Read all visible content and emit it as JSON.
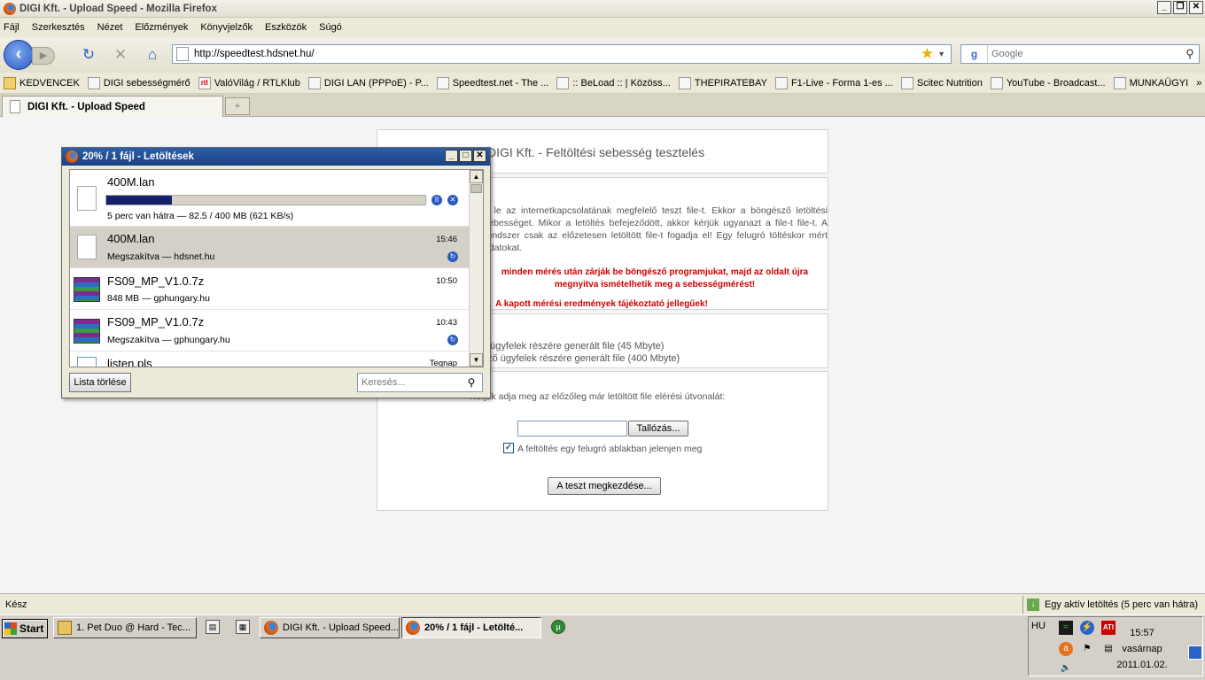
{
  "window": {
    "title": "DIGI Kft. - Upload Speed - Mozilla Firefox"
  },
  "menu": [
    "Fájl",
    "Szerkesztés",
    "Nézet",
    "Előzmények",
    "Könyvjelzők",
    "Eszközök",
    "Súgó"
  ],
  "nav": {
    "url": "http://speedtest.hdsnet.hu/",
    "search_placeholder": "Google"
  },
  "bookmarks": [
    "KEDVENCEK",
    "DIGI sebességmérő",
    "ValóVilág / RTLKlub",
    "DIGI LAN (PPPoE) - P...",
    "Speedtest.net - The ...",
    ":: BeLoad :: | Közöss...",
    "THEPIRATEBAY",
    "F1-Live - Forma 1-es ...",
    "Scitec Nutrition",
    "YouTube - Broadcast...",
    "MUNKAÜGYI"
  ],
  "bookmark_overflow": "»",
  "tab": {
    "label": "DIGI Kft. - Upload Speed"
  },
  "page": {
    "heading": "DIGI Kft. - Feltöltési sebesség tesztelés",
    "info_text": "e le az internetkapcsolatának megfelelő teszt file-t. Ekkor a böngésző letöltési sebességet. Mikor a letöltés befejeződött, akkor kérjük ugyanazt a file-t file-t. A rendszer csak az előzetesen letöltött file-t fogadja el! Egy felugró töltéskor mért adatokat.",
    "warning1": "minden mérés után zárják be böngésző programjukat, majd az oldalt újra megnyitva ismételhetik meg a sebességmérést!",
    "warning2": "A kapott mérési eredmények tájékoztató jellegűek!",
    "file1": "ő ügyfelek részére generált file (45 Mbyte)",
    "file2": "ező ügyfelek részére generált file (400 Mbyte)",
    "path_label": "Kérjük adja meg az előzőleg már letöltött file elérési útvonalát:",
    "browse_button": "Tallózás...",
    "popup_checkbox_label": "A feltöltés egy felugró ablakban jelenjen meg",
    "start_button": "A teszt megkezdése..."
  },
  "downloads": {
    "title": "20% / 1 fájl - Letöltések",
    "items": [
      {
        "name": "400M.lan",
        "status": "5 perc van hátra — 82.5 / 400 MB (621 KB/s)",
        "progress": 0.206
      },
      {
        "name": "400M.lan",
        "status": "Megszakítva — hdsnet.hu",
        "time": "15:46"
      },
      {
        "name": "FS09_MP_V1.0.7z",
        "status": "848 MB — gphungary.hu",
        "time": "10:50"
      },
      {
        "name": "FS09_MP_V1.0.7z",
        "status": "Megszakítva — gphungary.hu",
        "time": "10:43"
      },
      {
        "name": "listen.pls",
        "time": "Tegnap"
      }
    ],
    "clear_button": "Lista törlése",
    "search_placeholder": "Keresés..."
  },
  "statusbar": {
    "left": "Kész",
    "right": "Egy aktív letöltés (5 perc van hátra)"
  },
  "taskbar": {
    "start": "Start",
    "tasks": [
      "1. Pet Duo @ Hard - Tec...",
      "DIGI Kft. - Upload Speed...",
      "20% / 1 fájl - Letölté..."
    ],
    "lang": "HU",
    "time": "15:57",
    "day": "vasárnap",
    "date": "2011.01.02."
  }
}
